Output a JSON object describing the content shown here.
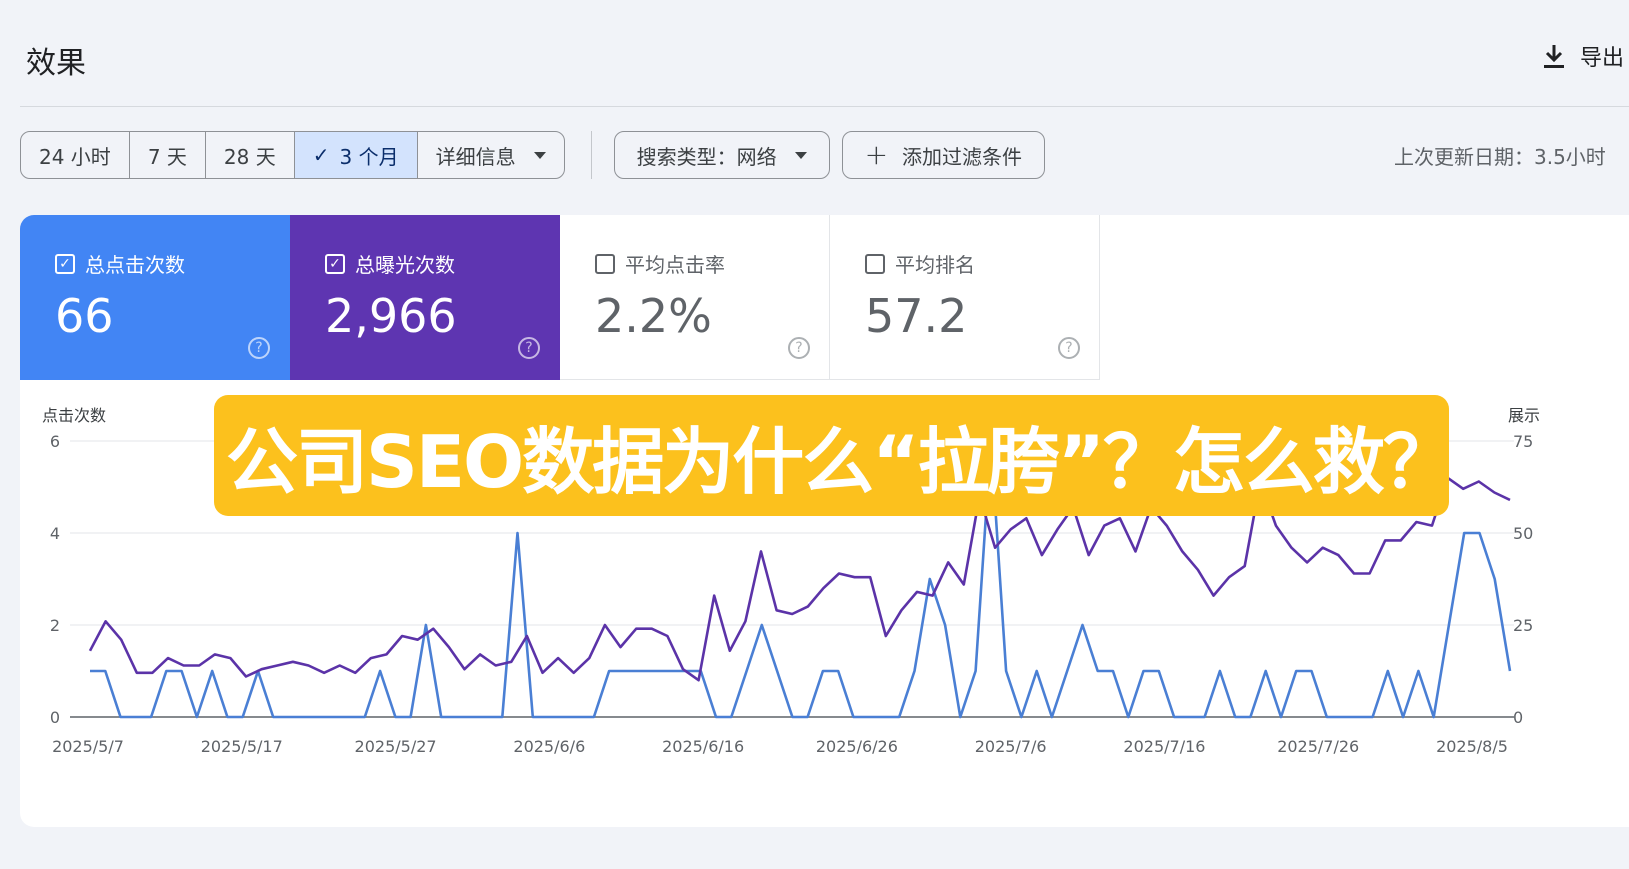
{
  "header": {
    "title": "效果",
    "export_label": "导出"
  },
  "toolbar": {
    "date_ranges": [
      {
        "label": "24 小时",
        "active": false
      },
      {
        "label": "7 天",
        "active": false
      },
      {
        "label": "28 天",
        "active": false
      },
      {
        "label": "3 个月",
        "active": true
      }
    ],
    "details_label": "详细信息",
    "search_type_label": "搜索类型：网络",
    "add_filter_label": "添加过滤条件",
    "updated_label": "上次更新日期：3.5小时"
  },
  "metrics": [
    {
      "label": "总点击次数",
      "value": "66",
      "checked": true,
      "color": "#4285f4"
    },
    {
      "label": "总曝光次数",
      "value": "2,966",
      "checked": true,
      "color": "#5e35b1"
    },
    {
      "label": "平均点击率",
      "value": "2.2%",
      "checked": false
    },
    {
      "label": "平均排名",
      "value": "57.2",
      "checked": false
    }
  ],
  "overlay": {
    "text": "公司SEO数据为什么“拉胯”？怎么救？"
  },
  "chart_data": {
    "type": "line",
    "left_axis_label": "点击次数",
    "right_axis_label": "展示",
    "left_ticks": [
      "0",
      "2",
      "4",
      "6"
    ],
    "right_ticks": [
      "0",
      "25",
      "50",
      "75"
    ],
    "left_range": [
      0,
      6
    ],
    "right_range": [
      0,
      75
    ],
    "x_labels": [
      "2025/5/7",
      "2025/5/17",
      "2025/5/27",
      "2025/6/6",
      "2025/6/16",
      "2025/6/26",
      "2025/7/6",
      "2025/7/16",
      "2025/7/26",
      "2025/8/5"
    ],
    "series": [
      {
        "axis": "left",
        "color": "#4a7fd4",
        "values": [
          1,
          1,
          0,
          0,
          0,
          1,
          1,
          0,
          1,
          0,
          0,
          1,
          0,
          0,
          0,
          0,
          0,
          0,
          0,
          1,
          0,
          0,
          2,
          0,
          0,
          0,
          0,
          0,
          4,
          0,
          0,
          0,
          0,
          0,
          1,
          1,
          1,
          1,
          1,
          1,
          1,
          0,
          0,
          1,
          2,
          1,
          0,
          0,
          1,
          1,
          0,
          0,
          0,
          0,
          1,
          3,
          2,
          0,
          1,
          6,
          1,
          0,
          1,
          0,
          1,
          2,
          1,
          1,
          0,
          1,
          1,
          0,
          0,
          0,
          1,
          0,
          0,
          1,
          0,
          1,
          1,
          0,
          0,
          0,
          0,
          1,
          0,
          1,
          0,
          2,
          4,
          4,
          3,
          1
        ]
      },
      {
        "axis": "right",
        "color": "#5b33a8",
        "values": [
          18,
          26,
          21,
          12,
          12,
          16,
          14,
          14,
          17,
          16,
          11,
          13,
          14,
          15,
          14,
          12,
          14,
          12,
          16,
          17,
          22,
          21,
          24,
          19,
          13,
          17,
          14,
          15,
          22,
          12,
          16,
          12,
          16,
          25,
          19,
          24,
          24,
          22,
          13,
          10,
          33,
          18,
          26,
          45,
          29,
          28,
          30,
          35,
          39,
          38,
          38,
          22,
          29,
          34,
          33,
          42,
          36,
          60,
          46,
          51,
          54,
          44,
          51,
          57,
          44,
          52,
          54,
          45,
          57,
          52,
          45,
          40,
          33,
          38,
          41,
          64,
          52,
          46,
          42,
          46,
          44,
          39,
          39,
          48,
          48,
          53,
          52,
          65,
          62,
          64,
          61,
          59
        ]
      }
    ]
  }
}
